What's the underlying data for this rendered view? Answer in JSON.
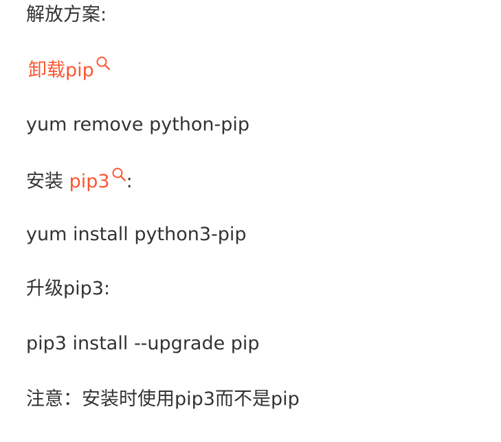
{
  "lines": {
    "solution_heading": "解放方案:",
    "uninstall_link": "卸载pip",
    "cmd_remove": "yum remove python-pip",
    "install_prefix": "安装 ",
    "install_link": "pip3",
    "install_suffix": ":",
    "cmd_install": "yum install python3-pip",
    "upgrade_heading": "升级pip3:",
    "cmd_upgrade": "pip3 install --upgrade pip",
    "note": "注意：安装时使用pip3而不是pip"
  },
  "icons": {
    "search": "search-icon"
  },
  "colors": {
    "text": "#333333",
    "link": "#fc5531"
  }
}
